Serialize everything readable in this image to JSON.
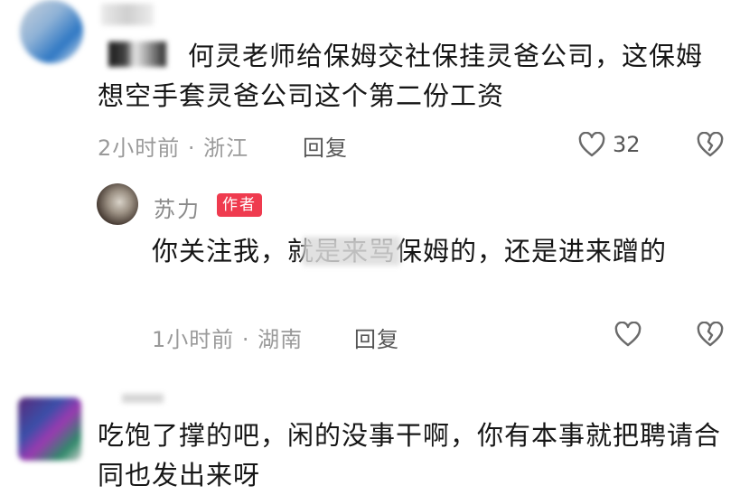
{
  "comment1": {
    "text": "何灵老师给保姆交社保挂灵爸公司，这保姆想空手套灵爸公司这个第二份工资",
    "time_location": "2小时前 · 浙江",
    "reply_label": "回复",
    "like_count": "32",
    "icons": [
      "heart-icon",
      "broken-heart-icon"
    ]
  },
  "reply1": {
    "author": "苏力",
    "badge": "作者",
    "text": "你关注我，就是来骂保姆的，还是进来蹭的",
    "time_location": "1小时前 · 湖南",
    "reply_label": "回复",
    "icons": [
      "heart-icon",
      "broken-heart-icon"
    ]
  },
  "comment2": {
    "text": "吃饱了撑的吧，闲的没事干啊，你有本事就把聘请合同也发出来呀"
  },
  "colors": {
    "badge": "#ef3b4f",
    "meta": "#9a9a9a",
    "text": "#161616"
  }
}
